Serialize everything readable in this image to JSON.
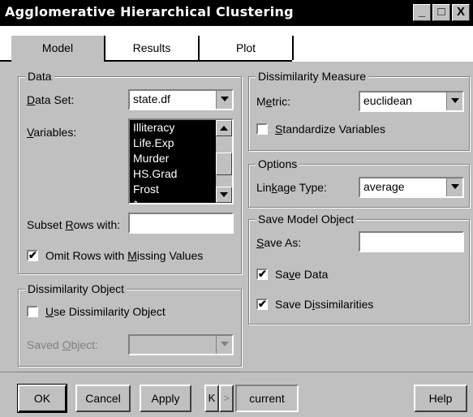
{
  "window": {
    "title": "Agglomerative Hierarchical Clustering",
    "minimize_glyph": "_",
    "maximize_glyph": "□",
    "close_glyph": "X"
  },
  "tabs": [
    {
      "label": "Model",
      "active": true
    },
    {
      "label": "Results",
      "active": false
    },
    {
      "label": "Plot",
      "active": false
    }
  ],
  "data_group": {
    "legend": "Data",
    "dataset_label_u": "D",
    "dataset_label_rest": "ata Set:",
    "dataset_value": "state.df",
    "variables_label_u": "V",
    "variables_label_rest": "ariables:",
    "variables": [
      "Illiteracy",
      "Life.Exp",
      "Murder",
      "HS.Grad",
      "Frost",
      "^"
    ],
    "subset_label_pre": "Subset ",
    "subset_label_u": "R",
    "subset_label_rest": "ows with:",
    "subset_value": "",
    "omit_checked": true,
    "omit_label_pre": "Omit Rows with ",
    "omit_label_u": "M",
    "omit_label_rest": "issing Values"
  },
  "dissim_object_group": {
    "legend": "Dissimilarity Object",
    "use_checked": false,
    "use_label_u": "U",
    "use_label_rest": "se Dissimilarity Object",
    "saved_label_pre": "Saved ",
    "saved_label_u": "O",
    "saved_label_rest": "bject:",
    "saved_value": ""
  },
  "dissim_measure_group": {
    "legend": "Dissimilarity Measure",
    "metric_label_pre": "M",
    "metric_label_u": "e",
    "metric_label_rest": "tric:",
    "metric_value": "euclidean",
    "standardize_checked": false,
    "standardize_label_u": "S",
    "standardize_label_rest": "tandardize Variables"
  },
  "options_group": {
    "legend": "Options",
    "linkage_label_pre": "Lin",
    "linkage_label_u": "k",
    "linkage_label_rest": "age Type:",
    "linkage_value": "average"
  },
  "save_group": {
    "legend": "Save Model Object",
    "save_as_label_u": "S",
    "save_as_label_rest": "ave As:",
    "save_as_value": "",
    "save_data_checked": true,
    "save_data_pre": "Sa",
    "save_data_u": "v",
    "save_data_rest": "e Data",
    "save_dissim_checked": true,
    "save_dissim_pre": "Save D",
    "save_dissim_u": "i",
    "save_dissim_rest": "ssimilarities"
  },
  "buttons": {
    "ok": "OK",
    "cancel": "Cancel",
    "apply": "Apply",
    "prev": "K",
    "next": ">",
    "current": "current",
    "help": "Help"
  },
  "check_mark": "✔"
}
